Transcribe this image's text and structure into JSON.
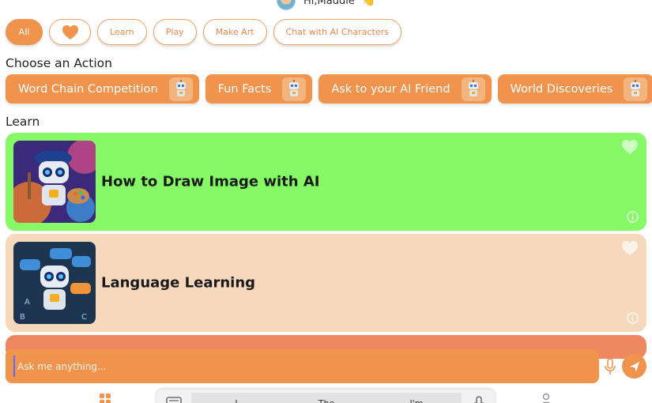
{
  "header": {
    "greeting": "Hi,Maddie",
    "wave_icon": "waving-hand-icon"
  },
  "filters": [
    {
      "label": "All",
      "active": true
    },
    {
      "label": "",
      "icon": "heart-icon"
    },
    {
      "label": "Learn"
    },
    {
      "label": "Play"
    },
    {
      "label": "Make Art"
    },
    {
      "label": "Chat with AI Characters"
    }
  ],
  "actions_section": {
    "title": "Choose an Action",
    "items": [
      {
        "label": "Word Chain Competition",
        "icon": "robot-icon"
      },
      {
        "label": "Fun Facts",
        "icon": "robot-icon"
      },
      {
        "label": "Ask to your AI Friend",
        "icon": "robot-icon"
      },
      {
        "label": "World Discoveries",
        "icon": "robot-icon"
      }
    ]
  },
  "learn_section": {
    "title": "Learn",
    "cards": [
      {
        "title": "How to Draw Image with AI",
        "bg": "#85f966",
        "icon": "robot-painter-image"
      },
      {
        "title": "Language Learning",
        "bg": "#f6d8bd",
        "icon": "robot-languages-image"
      },
      {
        "title": "",
        "bg": "#ef8760"
      }
    ]
  },
  "chat": {
    "placeholder": "Ask me anything..."
  },
  "keyboard_suggestions": [
    "I",
    "The",
    "I'm"
  ],
  "colors": {
    "accent": "#f0944d",
    "card_green": "#85f966",
    "card_peach": "#f6d8bd",
    "card_coral": "#ef8760"
  }
}
